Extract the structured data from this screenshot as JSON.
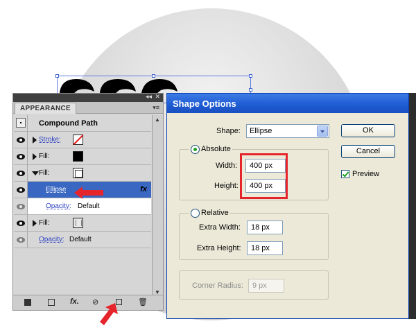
{
  "appearance_panel": {
    "tab_label": "APPEARANCE",
    "collapse_glyph": "◂◂",
    "close_glyph": "✕",
    "menu_glyph": "▾≡",
    "rows": {
      "header": "Compound Path",
      "stroke": "Stroke:",
      "fill1": "Fill:",
      "fill2": "Fill:",
      "effect": "Ellipse",
      "opacity1_label": "Opacity:",
      "opacity1_value": "Default",
      "fill3": "Fill:",
      "opacity2_label": "Opacity:",
      "opacity2_value": "Default"
    },
    "fx_label": "fx",
    "bottom_fx": "fx."
  },
  "shape_options": {
    "title": "Shape Options",
    "shape_label": "Shape:",
    "shape_value": "Ellipse",
    "absolute_label": "Absolute",
    "width_label": "Width:",
    "width_value": "400 px",
    "height_label": "Height:",
    "height_value": "400 px",
    "relative_label": "Relative",
    "extra_width_label": "Extra Width:",
    "extra_width_value": "18 px",
    "extra_height_label": "Extra Height:",
    "extra_height_value": "18 px",
    "corner_radius_label": "Corner Radius:",
    "corner_radius_value": "9 px",
    "ok_label": "OK",
    "cancel_label": "Cancel",
    "preview_label": "Preview"
  },
  "colors": {
    "accent_red": "#e5242c",
    "selected_row": "#3a67c2",
    "titlebar": "#1d5bd2"
  }
}
